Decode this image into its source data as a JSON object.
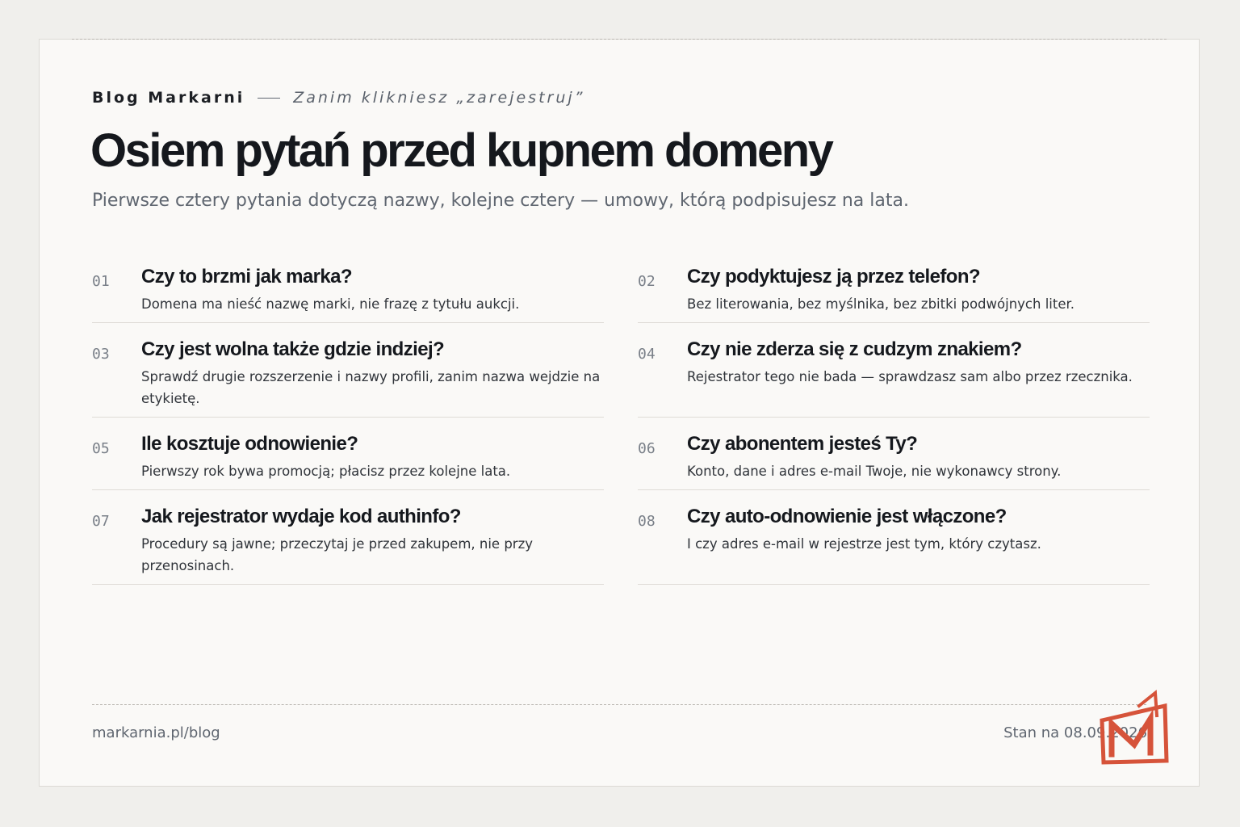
{
  "header": {
    "blog_name": "Blog Markarni",
    "series": "Zanim klikniesz „zarejestruj”",
    "title": "Osiem pytań przed kupnem domeny",
    "lede": "Pierwsze cztery pytania dotyczą nazwy, kolejne cztery — umowy, którą podpisujesz na lata."
  },
  "questions": [
    {
      "num": "01",
      "title": "Czy to brzmi jak marka?",
      "desc": "Domena ma nieść nazwę marki, nie frazę z tytułu aukcji."
    },
    {
      "num": "02",
      "title": "Czy podyktujesz ją przez telefon?",
      "desc": "Bez literowania, bez myślnika, bez zbitki podwójnych liter."
    },
    {
      "num": "03",
      "title": "Czy jest wolna także gdzie indziej?",
      "desc": "Sprawdź drugie rozszerzenie i nazwy profili, zanim nazwa wejdzie na etykietę."
    },
    {
      "num": "04",
      "title": "Czy nie zderza się z cudzym znakiem?",
      "desc": "Rejestrator tego nie bada — sprawdzasz sam albo przez rzecznika."
    },
    {
      "num": "05",
      "title": "Ile kosztuje odnowienie?",
      "desc": "Pierwszy rok bywa promocją; płacisz przez kolejne lata."
    },
    {
      "num": "06",
      "title": "Czy abonentem jesteś Ty?",
      "desc": "Konto, dane i adres e-mail Twoje, nie wykonawcy strony."
    },
    {
      "num": "07",
      "title": "Jak rejestrator wydaje kod authinfo?",
      "desc": "Procedury są jawne; przeczytaj je przed zakupem, nie przy przenosinach."
    },
    {
      "num": "08",
      "title": "Czy auto-odnowienie jest włączone?",
      "desc": "I czy adres e-mail w rejestrze jest tym, który czytasz."
    }
  ],
  "footer": {
    "url": "markarnia.pl/blog",
    "date": "Stan na 08.09.2026"
  },
  "logo": {
    "icon": "markarnia-m-logo-icon",
    "color": "#d6533a"
  }
}
